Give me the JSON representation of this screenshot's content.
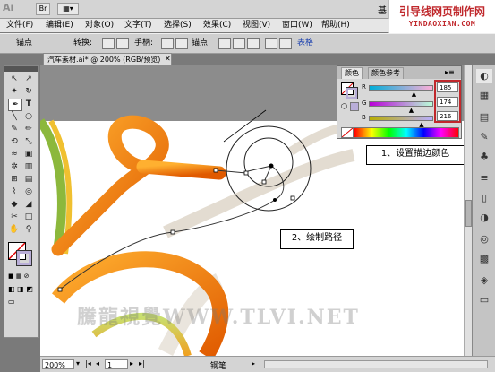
{
  "app": {
    "logo": "Ai",
    "brand_cn": "引导线网页制作网",
    "brand_en": "YINDAOXIAN.COM",
    "title_right": "基"
  },
  "titlebar": {
    "btn_br": "Br",
    "btn_layout": "▦▾"
  },
  "menus": [
    "文件(F)",
    "编辑(E)",
    "对象(O)",
    "文字(T)",
    "选择(S)",
    "效果(C)",
    "视图(V)",
    "窗口(W)",
    "帮助(H)"
  ],
  "controlbar": {
    "anchor_label": "锚点",
    "convert_label": "转换:",
    "handle_label": "手柄:",
    "anchor_point_label": "锚点:",
    "isolate_label": "表格"
  },
  "document_tab": "汽车素材.ai* @ 200% (RGB/预览)",
  "color_panel": {
    "tabs": [
      "颜色",
      "颜色参考"
    ],
    "r_label": "R",
    "g_label": "G",
    "b_label": "B",
    "r_value": "185",
    "g_value": "174",
    "b_value": "216",
    "r_fraction": 0.725,
    "g_fraction": 0.682,
    "b_fraction": 0.847,
    "stroke_color": "#b9aed8"
  },
  "callouts": {
    "step1": "1、设置描边颜色",
    "step2": "2、绘制路径"
  },
  "watermark": "騰龍視覺WWW.TLVI.NET",
  "statusbar": {
    "zoom": "200%",
    "page": "1",
    "tool_name": "钢笔"
  },
  "colors": {
    "accent_red": "#c0282c",
    "orange": "#f08010",
    "panel_bg": "#d8d8d8"
  },
  "icons": [
    "selection-icon",
    "direct-selection-icon",
    "magic-wand-icon",
    "lasso-icon",
    "pen-icon",
    "type-icon",
    "line-icon",
    "ellipse-icon",
    "brush-icon",
    "pencil-icon",
    "rotate-icon",
    "scale-icon",
    "warp-icon",
    "free-transform-icon",
    "symbol-sprayer-icon",
    "graph-icon",
    "mesh-icon",
    "gradient-icon",
    "eyedropper-icon",
    "blend-icon",
    "live-paint-icon",
    "slice-icon",
    "scissors-icon",
    "artboard-icon",
    "hand-icon",
    "zoom-icon"
  ]
}
